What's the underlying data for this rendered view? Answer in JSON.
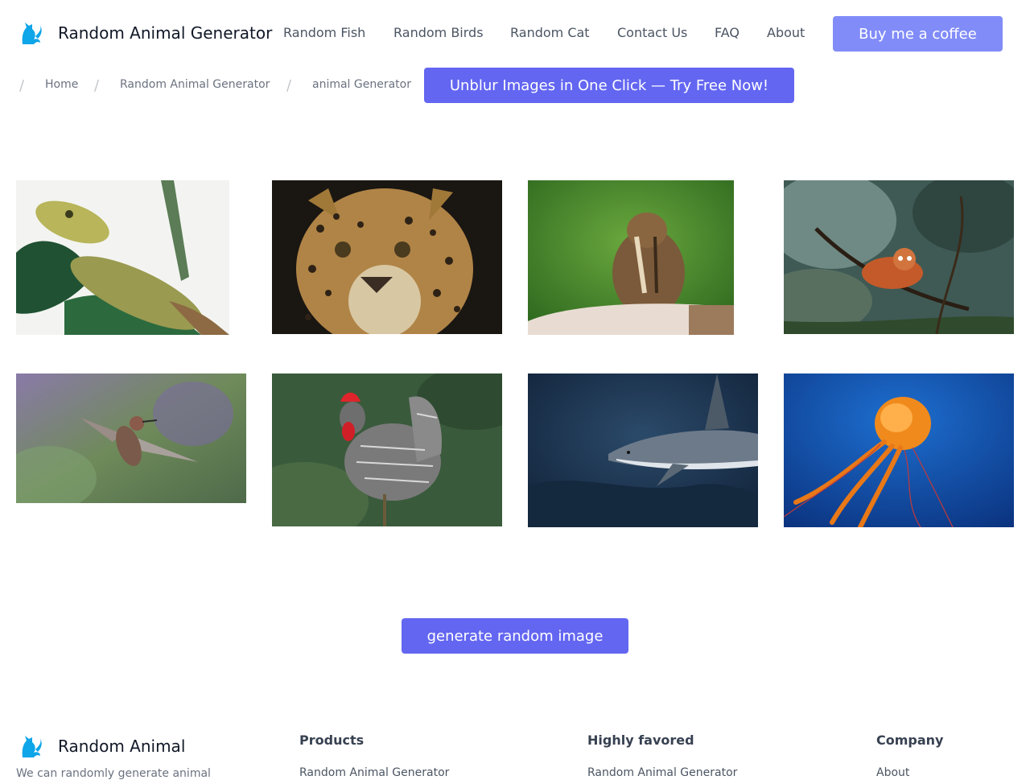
{
  "header": {
    "brand": "Random Animal Generator",
    "nav": [
      "Random Fish",
      "Random Birds",
      "Random Cat",
      "Contact Us",
      "FAQ",
      "About"
    ],
    "coffee_button": "Buy me a coffee"
  },
  "breadcrumb": {
    "items": [
      "Home",
      "Random Animal Generator",
      "animal Generator"
    ],
    "separator": "/"
  },
  "promo_button": "Unblur Images in One Click — Try Free Now!",
  "gallery": {
    "images": [
      "lizard",
      "leopard",
      "chipmunk",
      "red-panda",
      "hummingbird",
      "rooster",
      "shark",
      "jellyfish"
    ]
  },
  "generate_button": "generate random image",
  "footer": {
    "brand": "Random Animal",
    "description": "We can randomly generate animal",
    "columns": [
      {
        "title": "Products",
        "first_link": "Random Animal Generator"
      },
      {
        "title": "Highly favored",
        "first_link": "Random Animal Generator"
      },
      {
        "title": "Company",
        "first_link": "About"
      }
    ]
  },
  "colors": {
    "accent": "#6366f1",
    "accent_light": "#818cf8",
    "logo": "#0ea5e9"
  }
}
